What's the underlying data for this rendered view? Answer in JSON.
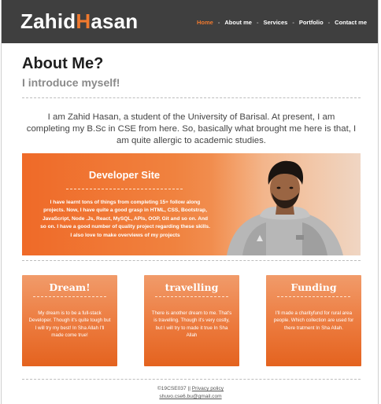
{
  "header": {
    "logo_first_initial": "Z",
    "logo_first_rest": "ahid",
    "logo_last_initial": "H",
    "logo_last_rest": "asan",
    "nav": [
      {
        "label": "Home",
        "active": true
      },
      {
        "label": "About me"
      },
      {
        "label": "Services"
      },
      {
        "label": "Portfolio"
      },
      {
        "label": "Contact me"
      }
    ],
    "nav_separator": "-"
  },
  "about": {
    "title": "About Me?",
    "subtitle": "I introduce myself!",
    "intro": "I am Zahid Hasan, a student of the University of Barisal. At present, I am completing my B.Sc in CSE from here. So, basically what brought me here is that, I am quite allergic to academic studies."
  },
  "developer": {
    "title": "Developer Site",
    "text": "I have learnt tons of things from completing 15+ follow along projects. Now, I have quite a good grasp in HTML, CSS, Bootstrap, JavaScript, Node .Js, React, MySQL, APIs, OOP, Git and so on. And so on. I have a good number of quality project regarding these skills. I also love to make overviews of my projects"
  },
  "cards": [
    {
      "title": "Dream!",
      "text": "My dream is to be a full-stack Developer. Though it's quite tough but I will try my best! In Sha Allah I'll made come true!"
    },
    {
      "title": "travelling",
      "text": "There is another dream to me. That's is travelling. Though it's very costly, but I will try to made it true In Sha Allah"
    },
    {
      "title": "Funding",
      "text": "I'll made a charityfund for rural area people. Which collection are used for there tratment In Sha Allah."
    }
  ],
  "footer": {
    "copyright": "©19CSE037",
    "separator": "||",
    "privacy": "Privacy policy",
    "email": "shuvo.cse6.bu@gmail.com"
  },
  "colors": {
    "accent": "#f0792e",
    "header_bg": "#3f3f3f"
  }
}
